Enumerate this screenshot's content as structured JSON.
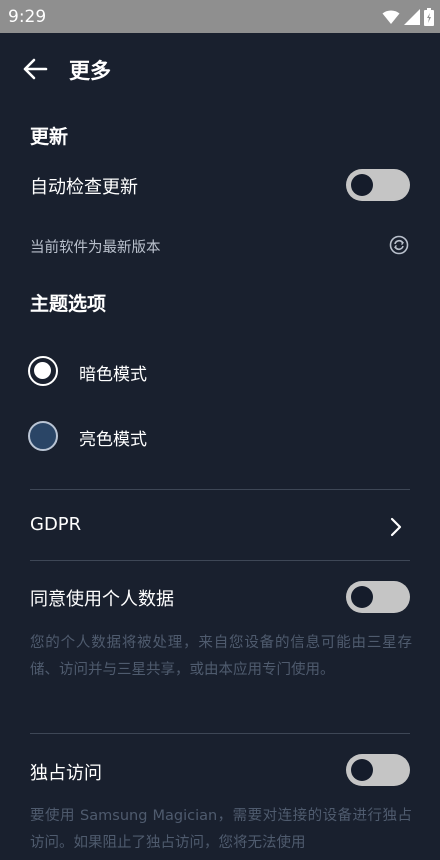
{
  "status_bar": {
    "time": "9:29",
    "icons": [
      "wifi-icon",
      "signal-icon",
      "battery-icon"
    ]
  },
  "header": {
    "back_icon": "arrow-left-icon",
    "title": "更多"
  },
  "update": {
    "section_title": "更新",
    "auto_check_label": "自动检查更新",
    "auto_check_enabled": false,
    "version_status": "当前软件为最新版本",
    "refresh_icon": "refresh-icon"
  },
  "theme": {
    "section_title": "主题选项",
    "options": [
      {
        "label": "暗色模式",
        "selected": true
      },
      {
        "label": "亮色模式",
        "selected": false
      }
    ]
  },
  "gdpr": {
    "label": "GDPR",
    "chevron_icon": "chevron-right-icon"
  },
  "personal_data": {
    "label": "同意使用个人数据",
    "enabled": false,
    "description": "您的个人数据将被处理，来自您设备的信息可能由三星存储、访问并与三星共享，或由本应用专门使用。"
  },
  "exclusive_access": {
    "label": "独占访问",
    "enabled": false,
    "description": "要使用 Samsung Magician，需要对连接的设备进行独占访问。如果阻止了独占访问，您将无法使用"
  },
  "colors": {
    "background": "#19202e",
    "status_bar": "#8f8f8f",
    "toggle_track": "#c5c5c5",
    "toggle_knob": "#151c2b",
    "divider": "#3e4756",
    "muted_text": "#4f5b6e",
    "secondary_text": "#b9c0cc"
  }
}
